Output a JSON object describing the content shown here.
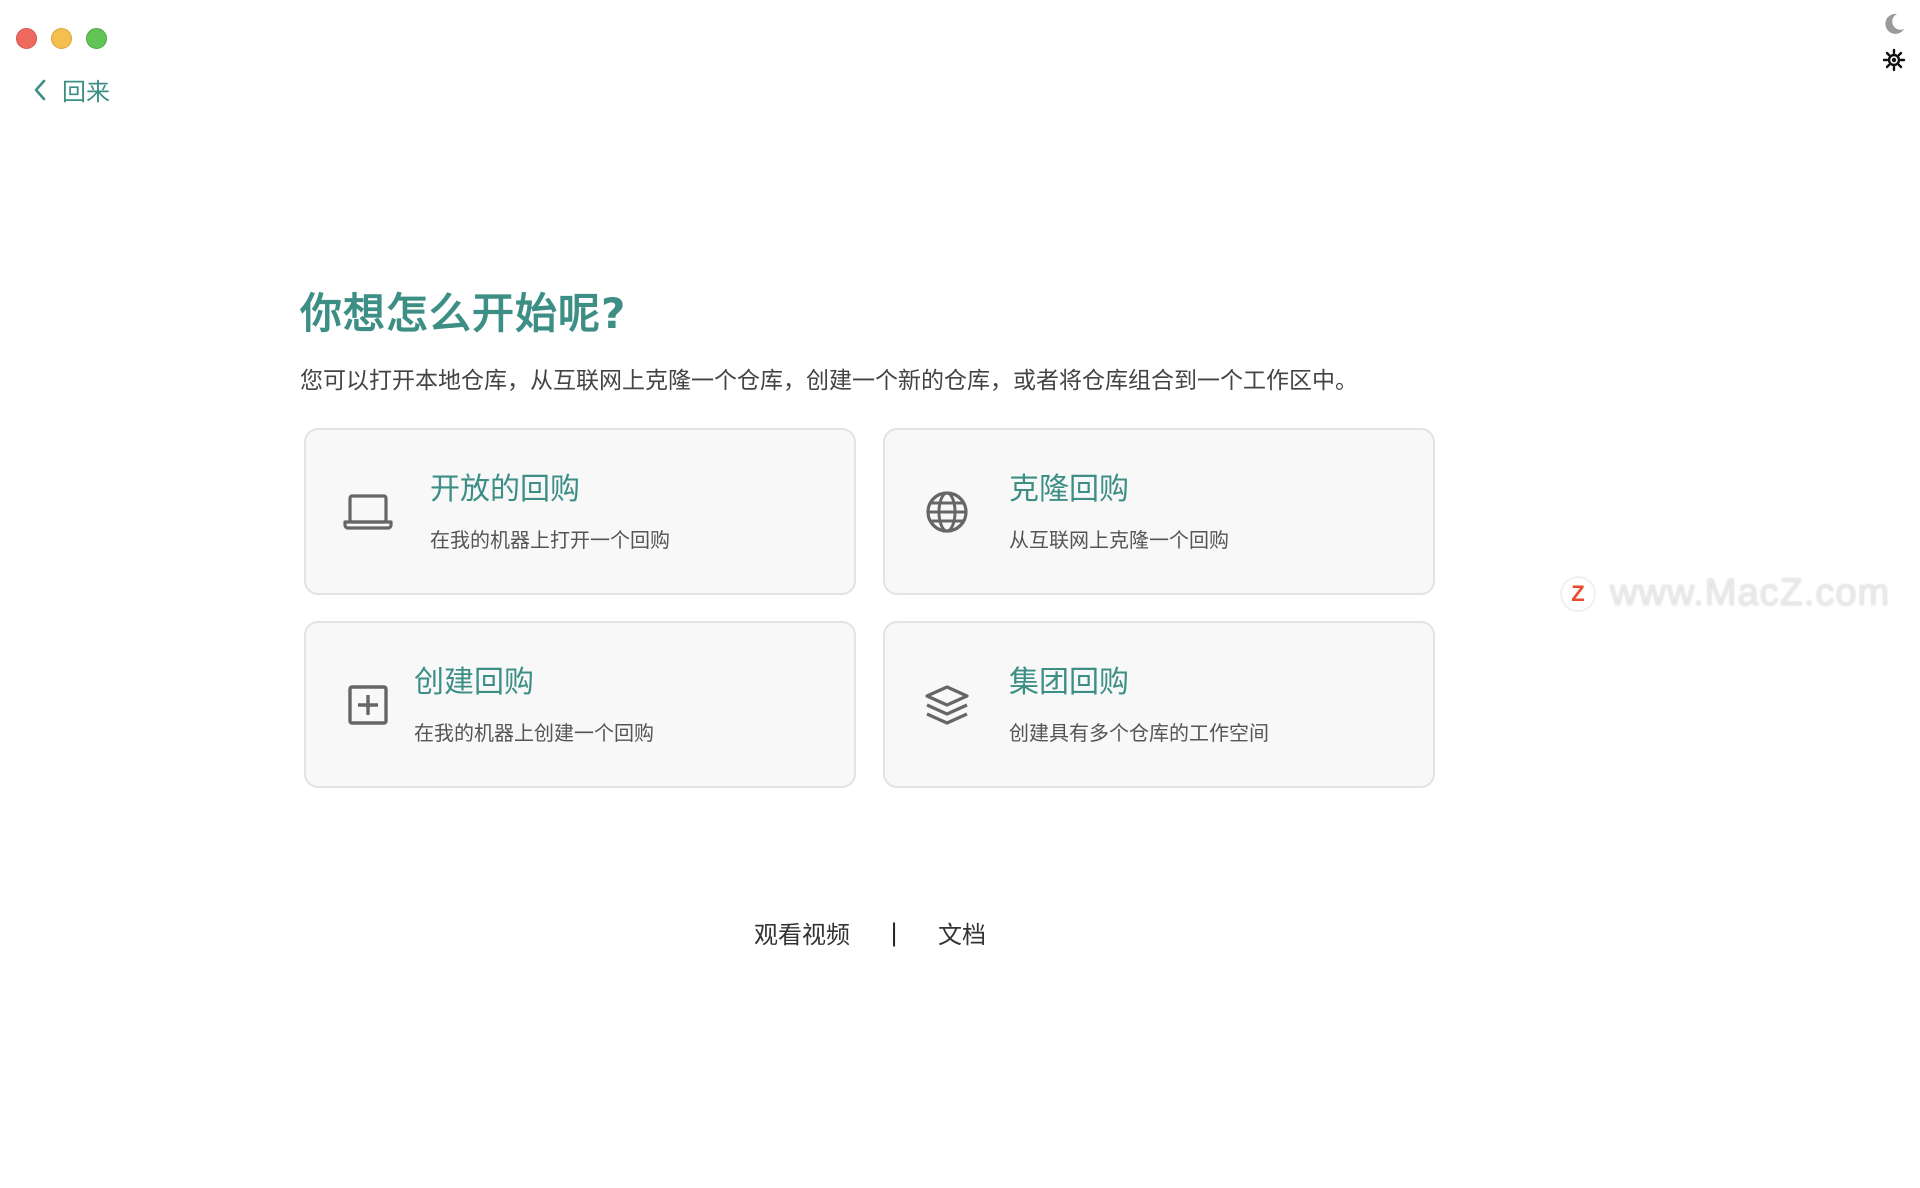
{
  "nav": {
    "back_label": "回来"
  },
  "theme": {
    "dark_icon": "moon-icon",
    "light_icon": "sun-icon"
  },
  "main": {
    "headline": "你想怎么开始呢?",
    "subtitle": "您可以打开本地仓库，从互联网上克隆一个仓库，创建一个新的仓库，或者将仓库组合到一个工作区中。"
  },
  "cards": [
    {
      "title": "开放的回购",
      "desc": "在我的机器上打开一个回购",
      "icon": "laptop-icon"
    },
    {
      "title": "克隆回购",
      "desc": "从互联网上克隆一个回购",
      "icon": "globe-icon"
    },
    {
      "title": "创建回购",
      "desc": "在我的机器上创建一个回购",
      "icon": "plus-square-icon"
    },
    {
      "title": "集团回购",
      "desc": "创建具有多个仓库的工作空间",
      "icon": "layers-icon"
    }
  ],
  "footer": {
    "video_link": "观看视频",
    "separator": "|",
    "docs_link": "文档"
  },
  "watermark": {
    "badge": "Z",
    "text": "www.MacZ.com"
  },
  "colors": {
    "accent": "#3d8f86",
    "card_bg": "#f8f8f8",
    "card_border": "#e3e3e3"
  }
}
